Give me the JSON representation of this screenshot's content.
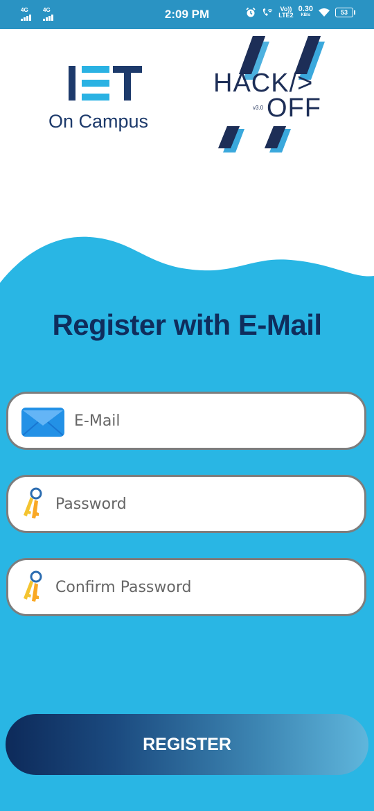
{
  "status_bar": {
    "network_left_1": "4G",
    "network_left_2": "4G",
    "time": "2:09 PM",
    "volte_label": "Vo))",
    "lte_label": "LTE2",
    "data_speed": "0.30",
    "data_unit": "KB/s",
    "battery": "53",
    "icons": [
      "alarm-icon",
      "wifi-call-icon",
      "wifi-icon",
      "battery-icon"
    ]
  },
  "logos": {
    "iet_text": "IET",
    "iet_subtitle": "On Campus",
    "hackoff_top": "HACK/>",
    "hackoff_bottom": "OFF",
    "hackoff_version": "v3.0"
  },
  "heading": "Register with E-Mail",
  "form": {
    "email_placeholder": "E-Mail",
    "password_placeholder": "Password",
    "confirm_placeholder": "Confirm Password",
    "register_label": "REGISTER"
  },
  "colors": {
    "status_bar": "#2a93c3",
    "background_blue": "#29b6e4",
    "heading_navy": "#0f2d5c",
    "button_gradient_start": "#0d2a5a",
    "button_gradient_end": "#5fb6dc"
  }
}
